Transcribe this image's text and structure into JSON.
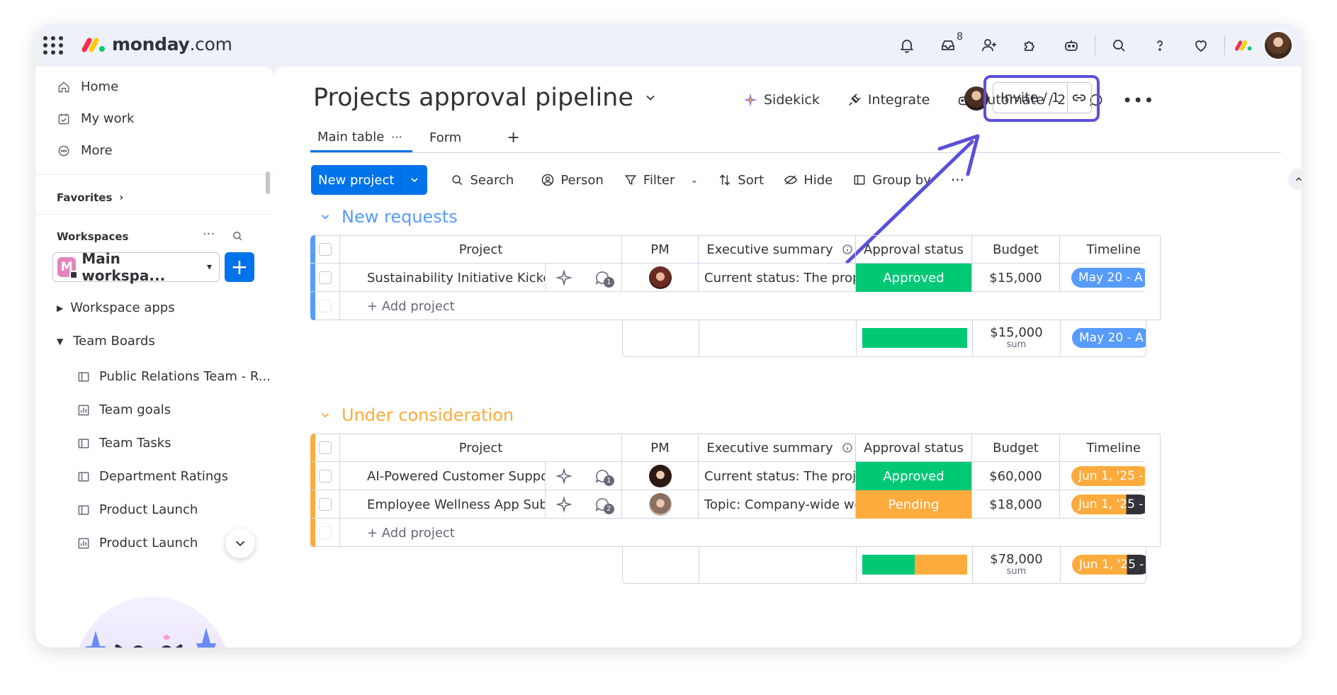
{
  "app": {
    "logo_text": "monday",
    "logo_suffix": ".com",
    "inbox_badge": "8"
  },
  "sidebar": {
    "home": "Home",
    "my_work": "My work",
    "more": "More",
    "favorites": "Favorites",
    "workspaces": "Workspaces",
    "workspace_name": "Main workspa...",
    "workspace_letter": "M",
    "workspace_apps": "Workspace apps",
    "team_boards": "Team Boards",
    "boards": [
      {
        "label": "Public Relations Team - R...",
        "icon": "board-icon"
      },
      {
        "label": "Team goals",
        "icon": "dashboard-icon"
      },
      {
        "label": "Team Tasks",
        "icon": "board-icon"
      },
      {
        "label": "Department Ratings",
        "icon": "board-icon"
      },
      {
        "label": "Product Launch",
        "icon": "board-icon"
      },
      {
        "label": "Product Launch",
        "icon": "dashboard-icon"
      }
    ]
  },
  "board": {
    "title": "Projects approval pipeline",
    "sidekick": "Sidekick",
    "integrate": "Integrate",
    "automate": "Automate / 2",
    "invite": "Invite / 1",
    "tabs": {
      "main": "Main table",
      "form": "Form"
    }
  },
  "toolbar": {
    "new_project": "New project",
    "search": "Search",
    "person": "Person",
    "filter": "Filter",
    "sort": "Sort",
    "hide": "Hide",
    "group_by": "Group by"
  },
  "columns": {
    "project": "Project",
    "pm": "PM",
    "exec": "Executive summary",
    "status": "Approval status",
    "budget": "Budget",
    "timeline": "Timeline"
  },
  "colors": {
    "approved": "#00c875",
    "pending": "#fdab3d",
    "blue_group": "#579bfc",
    "orange_group": "#fdab3d",
    "accent": "#0073ea",
    "highlight": "#5a4fd8"
  },
  "groups": [
    {
      "title": "New requests",
      "color": "#579bfc",
      "rows": [
        {
          "project": "Sustainability Initiative Kickoff",
          "updates": "1",
          "exec": "Current status: The proposa...",
          "status": "Approved",
          "budget": "$15,000",
          "timeline": "May 20 - A"
        }
      ],
      "add_label": "+ Add project",
      "sum_budget": "$15,000",
      "sum_label": "sum",
      "sum_timeline": "May 20 - A",
      "status_distribution": {
        "approved": 1.0,
        "pending": 0.0
      }
    },
    {
      "title": "Under consideration",
      "color": "#fdab3d",
      "rows": [
        {
          "project": "AI-Powered Customer Support B...",
          "updates": "1",
          "exec": "Current status: The project i...",
          "status": "Approved",
          "budget": "$60,000",
          "timeline": "Jun 1, '25 -"
        },
        {
          "project": "Employee Wellness App Subscri...",
          "updates": "2",
          "exec": "Topic: Company-wide welln...",
          "status": "Pending",
          "budget": "$18,000",
          "timeline": "Jun 1, '25 -"
        }
      ],
      "add_label": "+ Add project",
      "sum_budget": "$78,000",
      "sum_label": "sum",
      "sum_timeline": "Jun 1, '25 -",
      "status_distribution": {
        "approved": 0.5,
        "pending": 0.5
      }
    }
  ]
}
